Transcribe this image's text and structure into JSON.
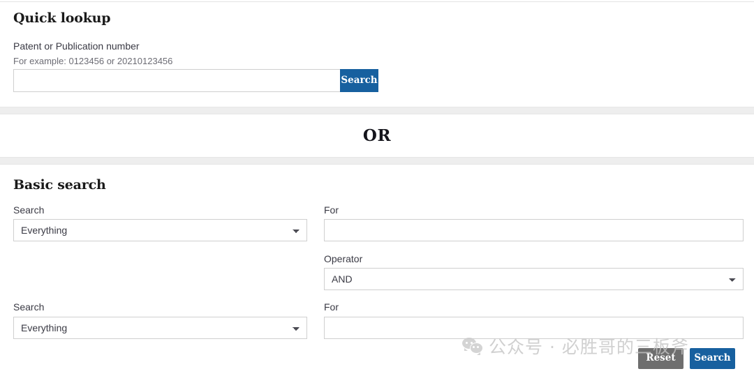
{
  "quick_lookup": {
    "title": "Quick lookup",
    "field_label": "Patent or Publication number",
    "hint": "For example: 0123456 or 20210123456",
    "input_value": "",
    "input_placeholder": "",
    "search_button": "Search"
  },
  "separator": {
    "text": "OR"
  },
  "basic_search": {
    "title": "Basic search",
    "rows": [
      {
        "search_label": "Search",
        "search_value": "Everything",
        "search_options": [
          "Everything"
        ],
        "for_label": "For",
        "for_value": "",
        "for_placeholder": ""
      },
      {
        "search_label": "Search",
        "search_value": "Everything",
        "search_options": [
          "Everything"
        ],
        "for_label": "For",
        "for_value": "",
        "for_placeholder": ""
      }
    ],
    "operator_label": "Operator",
    "operator_value": "AND",
    "operator_options": [
      "AND"
    ],
    "reset_button": "Reset",
    "search_button": "Search"
  },
  "watermark": {
    "icon": "wechat-icon",
    "text": "公众号 · 必胜哥的三板斧"
  },
  "colors": {
    "accent_blue": "#17609f",
    "reset_gray": "#6e6e6e",
    "band_gray": "#eeeeee",
    "border_gray": "#cfcfcf",
    "watermark_gray": "#c4c4c4"
  }
}
